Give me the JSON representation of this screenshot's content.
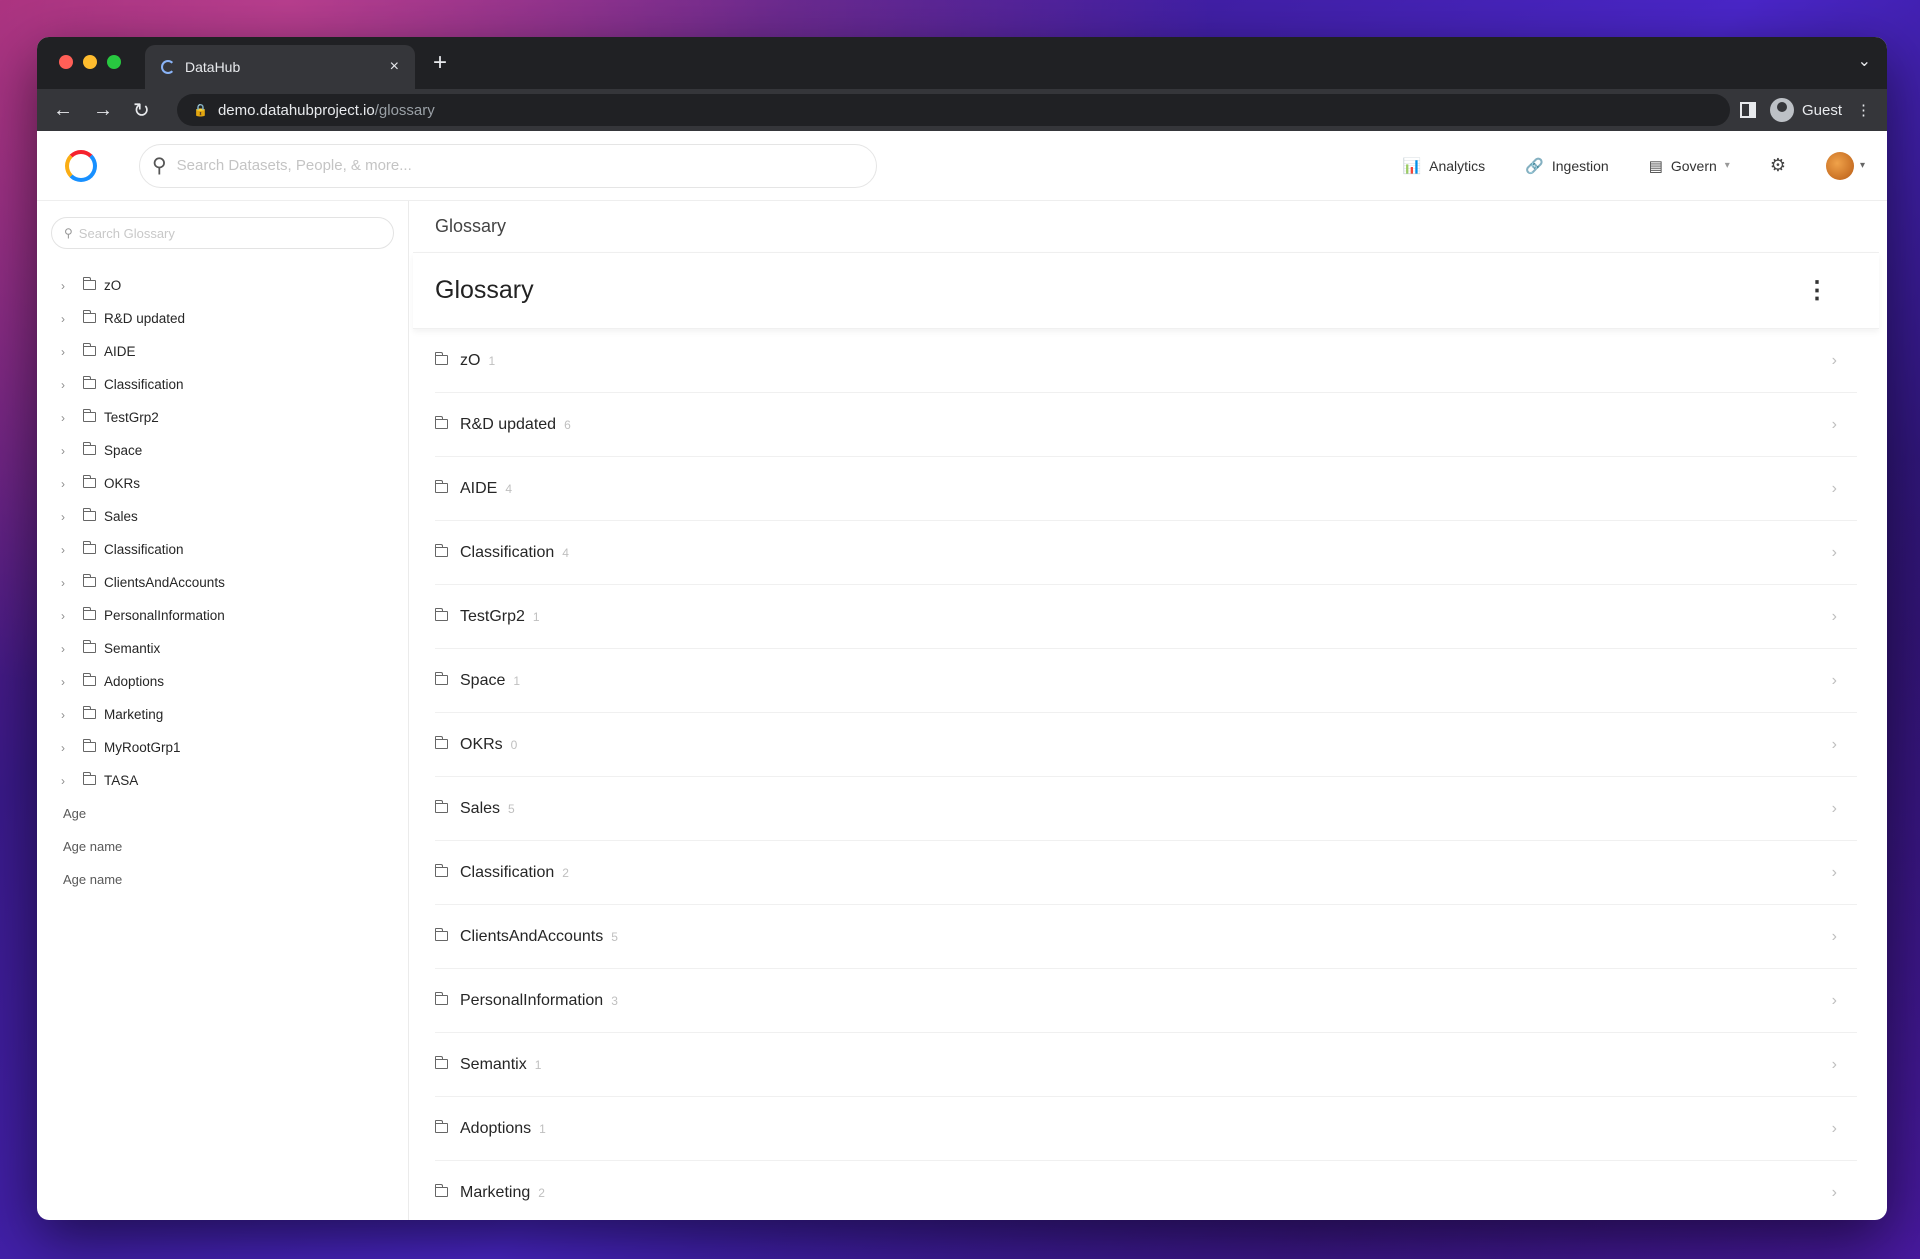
{
  "browser": {
    "tab_title": "DataHub",
    "tab_close": "×",
    "new_tab": "+",
    "tab_menu": "⌄",
    "url_host": "demo.datahubproject.io",
    "url_path": "/glossary",
    "profile_name": "Guest",
    "nav_icons": [
      "back-arrow-icon",
      "forward-arrow-icon",
      "reload-icon"
    ]
  },
  "header": {
    "search_placeholder": "Search Datasets, People, & more...",
    "nav": [
      {
        "label": "Analytics",
        "icon": "bar-chart-icon"
      },
      {
        "label": "Ingestion",
        "icon": "link-icon"
      },
      {
        "label": "Govern",
        "icon": "book-icon"
      }
    ]
  },
  "sidebar": {
    "search_placeholder": "Search Glossary",
    "nodes": [
      "zO",
      "R&D updated",
      "AIDE",
      "Classification",
      "TestGrp2",
      "Space",
      "OKRs",
      "Sales",
      "Classification",
      "ClientsAndAccounts",
      "PersonalInformation",
      "Semantix",
      "Adoptions",
      "Marketing",
      "MyRootGrp1",
      "TASA"
    ],
    "terms": [
      "Age",
      "Age name",
      "Age name"
    ]
  },
  "main": {
    "breadcrumb": "Glossary",
    "title": "Glossary",
    "nodes": [
      {
        "name": "zO",
        "count": "1"
      },
      {
        "name": "R&D updated",
        "count": "6"
      },
      {
        "name": "AIDE",
        "count": "4"
      },
      {
        "name": "Classification",
        "count": "4"
      },
      {
        "name": "TestGrp2",
        "count": "1"
      },
      {
        "name": "Space",
        "count": "1"
      },
      {
        "name": "OKRs",
        "count": "0"
      },
      {
        "name": "Sales",
        "count": "5"
      },
      {
        "name": "Classification",
        "count": "2"
      },
      {
        "name": "ClientsAndAccounts",
        "count": "5"
      },
      {
        "name": "PersonalInformation",
        "count": "3"
      },
      {
        "name": "Semantix",
        "count": "1"
      },
      {
        "name": "Adoptions",
        "count": "1"
      },
      {
        "name": "Marketing",
        "count": "2"
      }
    ]
  },
  "colors": {
    "traffic_red": "#ff5f57",
    "traffic_yellow": "#febc2e",
    "traffic_green": "#28c840"
  }
}
